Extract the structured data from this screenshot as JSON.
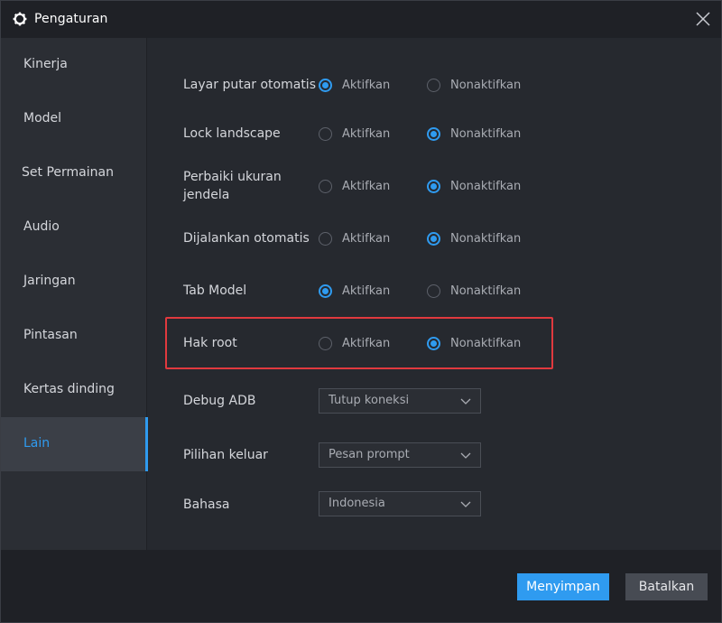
{
  "window": {
    "title": "Pengaturan"
  },
  "sidebar": {
    "items": [
      {
        "label": "Kinerja"
      },
      {
        "label": "Model"
      },
      {
        "label": "Set Permainan"
      },
      {
        "label": "Audio"
      },
      {
        "label": "Jaringan"
      },
      {
        "label": "Pintasan"
      },
      {
        "label": "Kertas dinding"
      },
      {
        "label": "Lain",
        "active": true
      }
    ]
  },
  "settings": {
    "option_on": "Aktifkan",
    "option_off": "Nonaktifkan",
    "rows": [
      {
        "label": "Layar putar otomatis",
        "selected": "Aktifkan"
      },
      {
        "label": "Lock landscape",
        "selected": "Nonaktifkan"
      },
      {
        "label": "Perbaiki ukuran jendela",
        "selected": "Nonaktifkan"
      },
      {
        "label": "Dijalankan otomatis",
        "selected": "Nonaktifkan"
      },
      {
        "label": "Tab Model",
        "selected": "Aktifkan"
      },
      {
        "label": "Hak root",
        "selected": "Nonaktifkan",
        "highlighted": true
      }
    ],
    "dropdowns": [
      {
        "label": "Debug ADB",
        "value": "Tutup koneksi"
      },
      {
        "label": "Pilihan keluar",
        "value": "Pesan prompt"
      },
      {
        "label": "Bahasa",
        "value": "Indonesia"
      }
    ]
  },
  "footer": {
    "save_label": "Menyimpan",
    "cancel_label": "Batalkan"
  },
  "colors": {
    "accent": "#2f9bf0",
    "highlight": "#e0393e",
    "background": "#26292f"
  },
  "icons": {
    "title": "gear-icon",
    "close": "close-icon",
    "dropdown": "chevron-down-icon"
  }
}
